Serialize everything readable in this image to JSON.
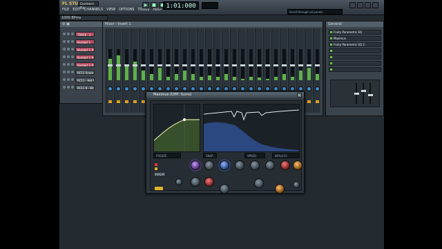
{
  "app": {
    "name": "FL STUDIO",
    "project": "Gurbani Rp",
    "time_display": "1:01:000",
    "hint": "Scroll through all panels",
    "menus": [
      "FILE",
      "EDIT",
      "CHANNELS",
      "VIEW",
      "OPTIONS",
      "TOOLS",
      "HELP"
    ],
    "pattern_label": "1000 BPms"
  },
  "step_sequencer": {
    "title": "",
    "channels": [
      {
        "label": "TRACK - 2 - IT",
        "color": "#b24b63"
      },
      {
        "label": "Kontakt 1",
        "color": "#b24b63"
      },
      {
        "label": "Kontakt 1 #2",
        "color": "#b24b63"
      },
      {
        "label": "Kontakt 1 #3",
        "color": "#b24b63"
      },
      {
        "label": "Kontakt 1 #4",
        "color": "#b24b63"
      },
      {
        "label": "RC11 Snare (S)",
        "color": "#4a5661"
      },
      {
        "label": "RC11 - Hat Flt",
        "color": "#4a5661"
      },
      {
        "label": "RC11 K - Kit #4",
        "color": "#4a5661"
      }
    ]
  },
  "mixer": {
    "title": "Mixer - Insert 1"
  },
  "fx_panel": {
    "title": "General",
    "slots": [
      "Fruity Parametric EQ",
      "Maximus",
      "Fruity Parametric EQ 2",
      "",
      "",
      "",
      ""
    ]
  },
  "plugin": {
    "title": "Maximus (UHP: Sums)",
    "close": "x",
    "brand": "HIGH",
    "controls": {
      "freeze": "FREEZE",
      "snap": "SNAP",
      "speed": "SPEED",
      "db": "80%/122"
    }
  }
}
